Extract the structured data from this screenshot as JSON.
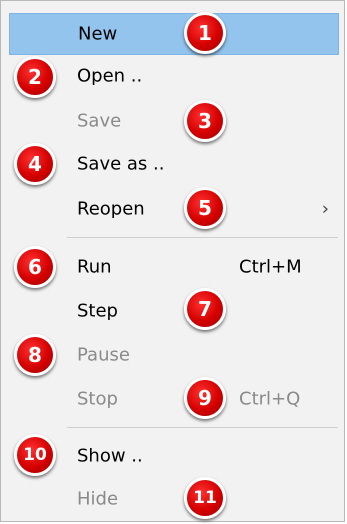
{
  "menu": {
    "items": [
      {
        "label": "New",
        "disabled": false,
        "highlighted": true,
        "shortcut": "",
        "submenu": false,
        "badge": "1"
      },
      {
        "label": "Open ..",
        "disabled": false,
        "highlighted": false,
        "shortcut": "",
        "submenu": false,
        "badge": "2"
      },
      {
        "label": "Save",
        "disabled": true,
        "highlighted": false,
        "shortcut": "",
        "submenu": false,
        "badge": "3"
      },
      {
        "label": "Save as ..",
        "disabled": false,
        "highlighted": false,
        "shortcut": "",
        "submenu": false,
        "badge": "4"
      },
      {
        "label": "Reopen",
        "disabled": false,
        "highlighted": false,
        "shortcut": "",
        "submenu": true,
        "submenu_glyph": "›",
        "badge": "5"
      },
      {
        "label": "Run",
        "disabled": false,
        "highlighted": false,
        "shortcut": "Ctrl+M",
        "submenu": false,
        "badge": "6"
      },
      {
        "label": "Step",
        "disabled": false,
        "highlighted": false,
        "shortcut": "",
        "submenu": false,
        "badge": "7"
      },
      {
        "label": "Pause",
        "disabled": true,
        "highlighted": false,
        "shortcut": "",
        "submenu": false,
        "badge": "8"
      },
      {
        "label": "Stop",
        "disabled": true,
        "highlighted": false,
        "shortcut": "Ctrl+Q",
        "submenu": false,
        "badge": "9"
      },
      {
        "label": "Show ..",
        "disabled": false,
        "highlighted": false,
        "shortcut": "",
        "submenu": false,
        "badge": "10"
      },
      {
        "label": "Hide",
        "disabled": true,
        "highlighted": false,
        "shortcut": "",
        "submenu": false,
        "badge": "11"
      }
    ]
  },
  "colors": {
    "highlight": "#93c4ee",
    "badge_red": "#d40000",
    "disabled_text": "#8a8a8a"
  }
}
